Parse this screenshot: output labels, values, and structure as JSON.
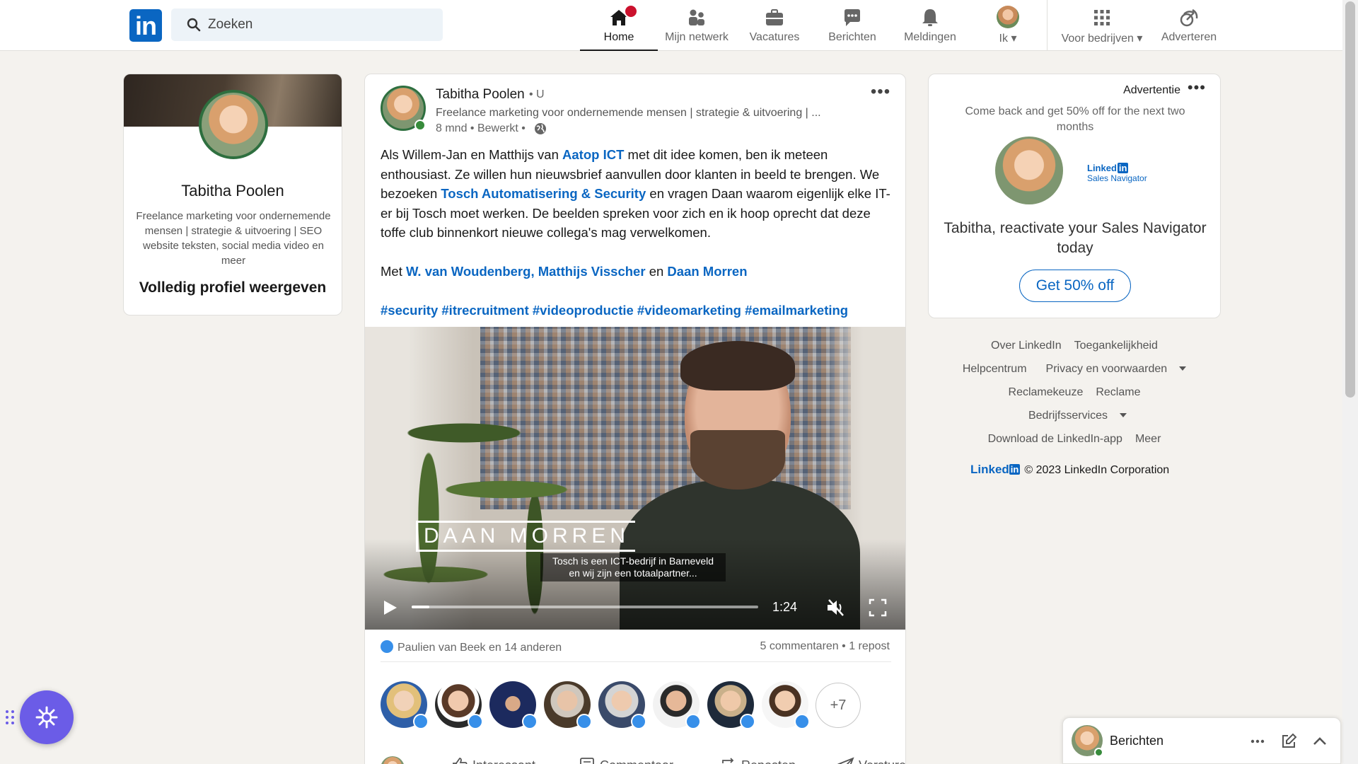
{
  "nav": {
    "logo_text": "in",
    "search_placeholder": "Zoeken",
    "items": [
      {
        "label": "Home",
        "icon": "home-icon"
      },
      {
        "label": "Mijn netwerk",
        "icon": "network-icon"
      },
      {
        "label": "Vacatures",
        "icon": "briefcase-icon"
      },
      {
        "label": "Berichten",
        "icon": "messaging-icon"
      },
      {
        "label": "Meldingen",
        "icon": "bell-icon"
      },
      {
        "label": "Ik",
        "icon": "avatar"
      },
      {
        "label": "Voor bedrijven",
        "icon": "grid-icon"
      },
      {
        "label": "Adverteren",
        "icon": "advertise-icon"
      }
    ],
    "active": "Home"
  },
  "profile": {
    "name": "Tabitha Poolen",
    "headline": "Freelance marketing voor ondernemende mensen | strategie & uitvoering | SEO website teksten, social media video en meer",
    "view_profile": "Volledig profiel weergeven"
  },
  "post": {
    "author": "Tabitha Poolen",
    "relation": "• U",
    "headline": "Freelance marketing voor ondernemende mensen | strategie & uitvoering | ...",
    "meta": "8 mnd • Bewerkt •",
    "more": "•••",
    "text": {
      "p1_a": "Als Willem-Jan en Matthijs van ",
      "p1_link1": "Aatop ICT",
      "p1_b": " met dit idee komen, ben ik meteen enthousiast. Ze willen hun nieuwsbrief aanvullen door klanten in beeld te brengen. We bezoeken ",
      "p1_link2": "Tosch Automatisering & Security",
      "p1_c": " en vragen Daan waarom eigenlijk elke IT-er bij Tosch moet werken. De beelden spreken voor zich en ik hoop oprecht dat deze toffe club binnenkort nieuwe collega's mag verwelkomen.",
      "p2_a": "Met ",
      "p2_link1": "W. van Woudenberg",
      "p2_sep": ", ",
      "p2_link2": "Matthijs Visscher",
      "p2_en": " en ",
      "p2_link3": "Daan Morren",
      "hashtags": "#security #itrecruitment #videoproductie #videomarketing #emailmarketing"
    },
    "video": {
      "name_overlay": "DAAN MORREN",
      "caption_line1": "Tosch is een ICT-bedrijf in Barneveld",
      "caption_line2": "en wij zijn een totaalpartner...",
      "time": "1:24",
      "progress": 0.05
    },
    "reactions_text": "Paulien van Beek en 14 anderen",
    "counts_text": "5 commentaren • 1 repost",
    "more_likers": "+7",
    "actions": [
      {
        "label": "Interessant",
        "icon": "like-icon"
      },
      {
        "label": "Commentaar",
        "icon": "comment-icon"
      },
      {
        "label": "Reposten",
        "icon": "repost-icon"
      },
      {
        "label": "Versturen",
        "icon": "send-icon"
      }
    ]
  },
  "ad": {
    "label": "Advertentie",
    "more": "•••",
    "offer": "Come back and get 50% off for the next two months",
    "logo_line1": "Linked",
    "logo_box": "in",
    "logo_line2": "Sales Navigator",
    "title": "Tabitha, reactivate your Sales Navigator today",
    "button": "Get 50% off"
  },
  "footer": {
    "links": [
      "Over LinkedIn",
      "Toegankelijkheid",
      "Helpcentrum",
      "Privacy en voorwaarden",
      "Reclamekeuze",
      "Reclame",
      "Bedrijfsservices",
      "Download de LinkedIn-app",
      "Meer"
    ],
    "brand_word": "Linked",
    "brand_box": "in",
    "copyright": "© 2023 LinkedIn Corporation"
  },
  "messaging": {
    "title": "Berichten"
  },
  "colors": {
    "brand": "#0a66c2",
    "background": "#f4f2ee",
    "notification": "#cb112d",
    "online": "#378b3b",
    "assistant": "#6b5ce7"
  }
}
